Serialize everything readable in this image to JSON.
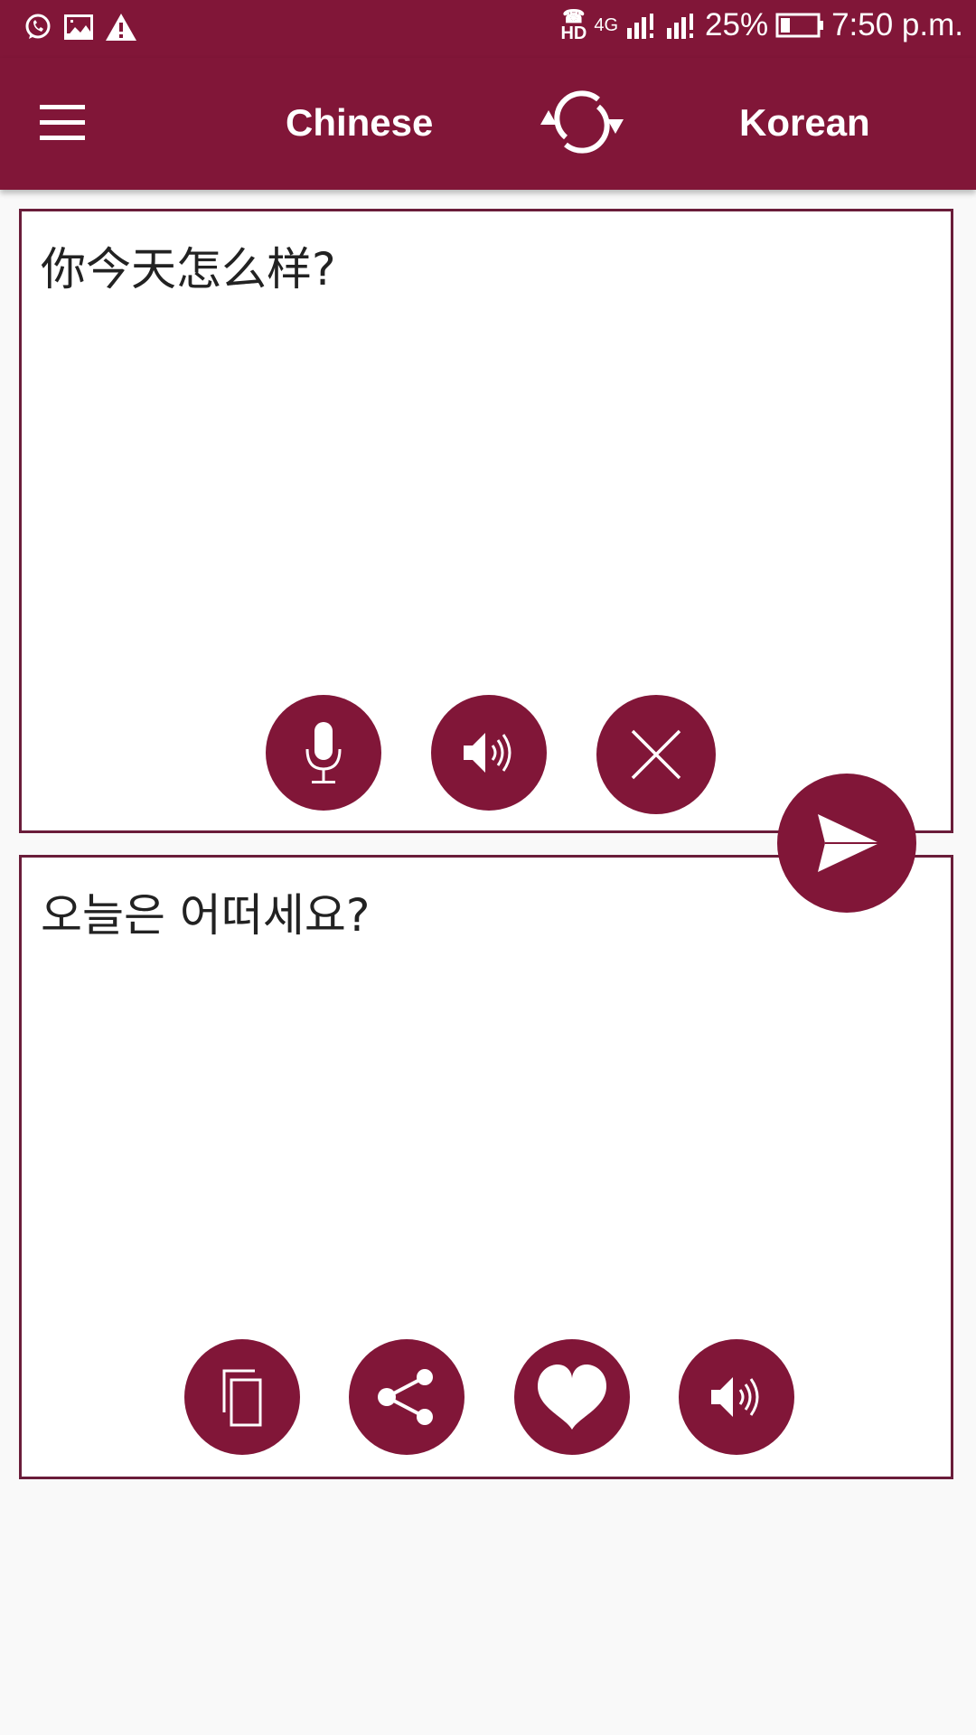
{
  "status_bar": {
    "left_icons": [
      "whatsapp-icon",
      "image-icon",
      "warning-icon"
    ],
    "hd_label": "HD",
    "network": "4G",
    "battery_percent": "25%",
    "time": "7:50 p.m."
  },
  "app_bar": {
    "source_language": "Chinese",
    "target_language": "Korean",
    "menu_icon": "hamburger-icon",
    "swap_icon": "swap-icon"
  },
  "input_panel": {
    "text": "你今天怎么样?",
    "buttons": [
      {
        "name": "microphone",
        "icon": "microphone-icon"
      },
      {
        "name": "speak",
        "icon": "speaker-icon"
      },
      {
        "name": "clear",
        "icon": "close-icon"
      }
    ]
  },
  "translate_button": {
    "icon": "send-icon"
  },
  "output_panel": {
    "text": "오늘은 어떠세요?",
    "buttons": [
      {
        "name": "copy",
        "icon": "copy-icon"
      },
      {
        "name": "share",
        "icon": "share-icon"
      },
      {
        "name": "favorite",
        "icon": "heart-icon"
      },
      {
        "name": "speak",
        "icon": "speaker-icon"
      }
    ]
  },
  "colors": {
    "primary": "#811638",
    "panel_border": "#6a1d3a",
    "background": "#f9f9f9",
    "text": "#222222"
  }
}
